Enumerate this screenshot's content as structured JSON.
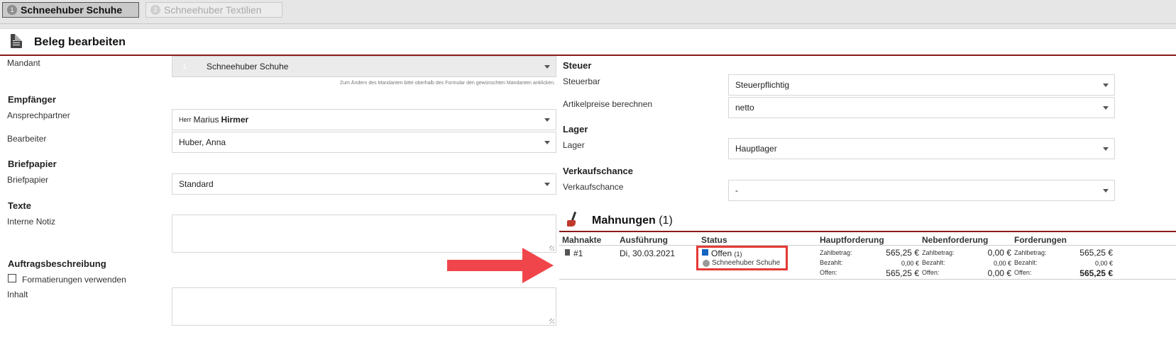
{
  "tabs": [
    {
      "num": "1",
      "label": "Schneehuber Schuhe"
    },
    {
      "num": "2",
      "label": "Schneehuber Textilien"
    }
  ],
  "panel": {
    "title": "Beleg bearbeiten"
  },
  "left": {
    "mandant_label": "Mandant",
    "mandant_num": "1",
    "mandant_value": "Schneehuber Schuhe",
    "mandant_hint": "Zum Ändern des Mandanten bitte oberhalb des Formular den gewünschten Mandanten anklicken.",
    "empfaenger_heading": "Empfänger",
    "ansprechpartner_label": "Ansprechpartner",
    "ansprechpartner_salutation": "Herr",
    "ansprechpartner_first": "Marius",
    "ansprechpartner_last": "Hirmer",
    "bearbeiter_label": "Bearbeiter",
    "bearbeiter_value": "Huber, Anna",
    "briefpapier_heading": "Briefpapier",
    "briefpapier_label": "Briefpapier",
    "briefpapier_value": "Standard",
    "texte_heading": "Texte",
    "interne_notiz_label": "Interne Notiz",
    "auftrag_heading": "Auftragsbeschreibung",
    "formatierungen_label": "Formatierungen verwenden",
    "inhalt_label": "Inhalt"
  },
  "right": {
    "steuer_heading": "Steuer",
    "steuerbar_label": "Steuerbar",
    "steuerbar_value": "Steuerpflichtig",
    "artikelpreise_label": "Artikelpreise berechnen",
    "artikelpreise_value": "netto",
    "lager_heading": "Lager",
    "lager_label": "Lager",
    "lager_value": "Hauptlager",
    "verkaufschance_heading": "Verkaufschance",
    "verkaufschance_label": "Verkaufschance",
    "verkaufschance_value": "-"
  },
  "mahnungen": {
    "title": "Mahnungen",
    "count": "(1)",
    "headers": [
      "Mahnakte",
      "Ausführung",
      "Status",
      "Hauptforderung",
      "Nebenforderung",
      "Forderungen"
    ],
    "row": {
      "akte": "#1",
      "datum": "Di, 30.03.2021",
      "status": "Offen",
      "status_count": "(1)",
      "mandant": "Schneehuber Schuhe",
      "haupt": {
        "zahl_label": "Zahlbetrag:",
        "zahl": "565,25 €",
        "bez_label": "Bezahlt:",
        "bez": "0,00 €",
        "off_label": "Offen:",
        "off": "565,25 €"
      },
      "neben": {
        "zahl_label": "Zahlbetrag:",
        "zahl": "0,00 €",
        "bez_label": "Bezahlt:",
        "bez": "0,00 €",
        "off_label": "Offen:",
        "off": "0,00 €"
      },
      "ford": {
        "zahl_label": "Zahlbetrag:",
        "zahl": "565,25 €",
        "bez_label": "Bezahlt:",
        "bez": "0,00 €",
        "off_label": "Offen:",
        "off": "565,25 €"
      }
    }
  },
  "colors": {
    "accent_line": "#8b1a1a",
    "highlight": "#e53935",
    "status_blue": "#1565c0"
  },
  "icons": [
    "document-icon",
    "brush-icon",
    "arrow-icon",
    "mini-document-icon",
    "status-square-icon",
    "client-circle-icon",
    "caret-down-icon"
  ]
}
